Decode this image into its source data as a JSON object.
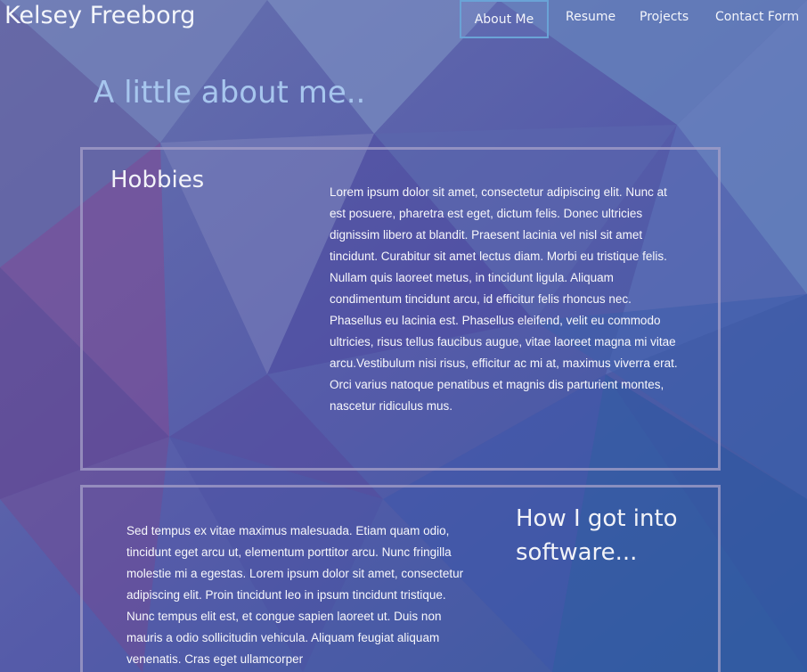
{
  "header": {
    "site_title": "Kelsey Freeborg",
    "nav": [
      {
        "label": "About Me",
        "active": true
      },
      {
        "label": "Resume",
        "active": false
      },
      {
        "label": "Projects",
        "active": false
      },
      {
        "label": "Contact Form",
        "active": false
      }
    ]
  },
  "main": {
    "heading": "A little about me..",
    "sections": [
      {
        "title": "Hobbies",
        "body": "Lorem ipsum dolor sit amet, consectetur adipiscing elit. Nunc at est posuere, pharetra est eget, dictum felis. Donec ultricies dignissim libero at blandit. Praesent lacinia vel nisl sit amet tincidunt. Curabitur sit amet lectus diam. Morbi eu tristique felis. Nullam quis laoreet metus, in tincidunt ligula. Aliquam condimentum tincidunt arcu, id efficitur felis rhoncus nec. Phasellus eu lacinia est. Phasellus eleifend, velit eu commodo ultricies, risus tellus faucibus augue, vitae laoreet magna mi vitae arcu.Vestibulum nisi risus, efficitur ac mi at, maximus viverra erat. Orci varius natoque penatibus et magnis dis parturient montes, nascetur ridiculus mus."
      },
      {
        "title": "How I got into software...",
        "body": "Sed tempus ex vitae maximus malesuada. Etiam quam odio, tincidunt eget arcu ut, elementum porttitor arcu. Nunc fringilla molestie mi a egestas. Lorem ipsum dolor sit amet, consectetur adipiscing elit. Proin tincidunt leo in ipsum tincidunt tristique. Nunc tempus elit est, et congue sapien laoreet ut. Duis non mauris a odio sollicitudin vehicula. Aliquam feugiat aliquam venenatis. Cras eget ullamcorper"
      }
    ]
  },
  "colors": {
    "accent_border": "#6aa3d6",
    "heading": "#a7c6ee",
    "card_border": "#a5a0c8"
  }
}
